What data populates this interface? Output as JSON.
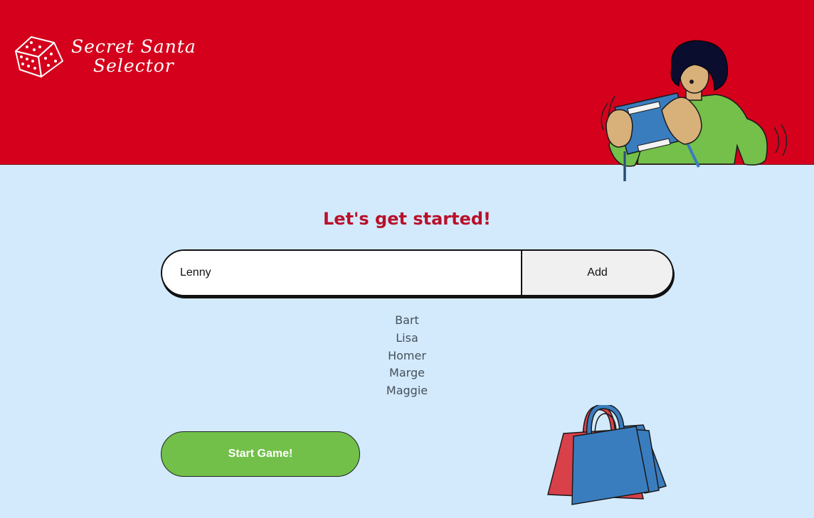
{
  "header": {
    "logo_line1": "Secret Santa",
    "logo_line2": "Selector",
    "logo_icon": "dice-icon",
    "illustration": "person-with-gift-illustration"
  },
  "main": {
    "title": "Let's get started!",
    "name_input_value": "Lenny",
    "add_label": "Add",
    "participants": [
      "Bart",
      "Lisa",
      "Homer",
      "Marge",
      "Maggie"
    ],
    "start_label": "Start Game!",
    "bags_illustration": "shopping-bags-illustration"
  },
  "colors": {
    "header_bg": "#d4001c",
    "page_bg": "#d3eafc",
    "title": "#b8102b",
    "start_button": "#72c04a",
    "add_button": "#f0f0f0"
  }
}
